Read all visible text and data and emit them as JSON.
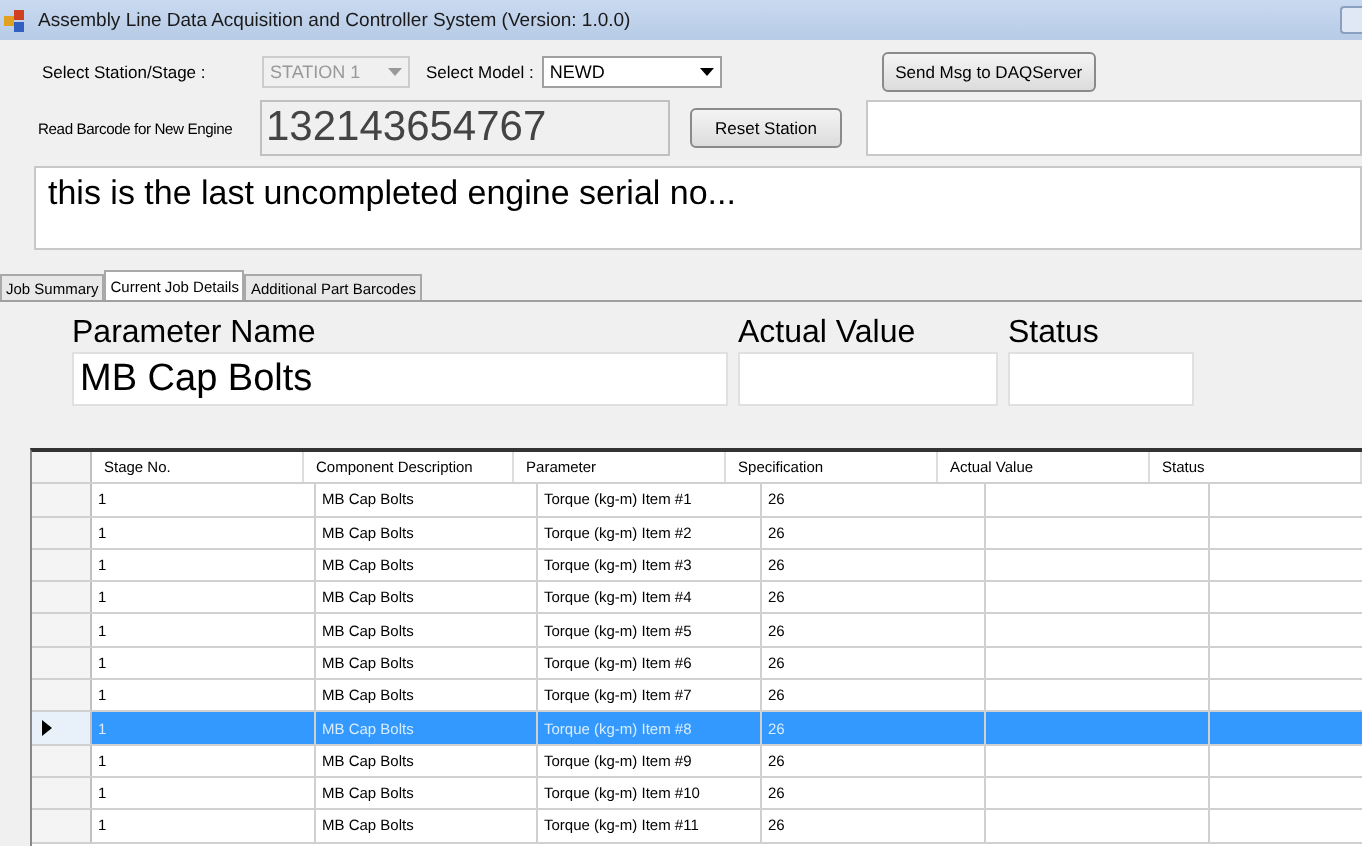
{
  "window": {
    "title": "Assembly Line Data Acquisition and Controller System (Version: 1.0.0)"
  },
  "station": {
    "label": "Select Station/Stage :",
    "value": "STATION 1",
    "disabled": true
  },
  "model": {
    "label": "Select Model :",
    "value": "NEWD",
    "disabled": false
  },
  "send_button": "Send Msg to DAQServer",
  "barcode": {
    "label": "Read Barcode for New Engine",
    "value": "132143654767"
  },
  "reset_button": "Reset Station",
  "message": "this is the last uncompleted engine serial no...",
  "tabs": [
    {
      "label": "Job Summary",
      "selected": false
    },
    {
      "label": "Current Job Details",
      "selected": true
    },
    {
      "label": "Additional Part Barcodes",
      "selected": false
    }
  ],
  "parameter": {
    "name_label": "Parameter Name",
    "name_value": "MB Cap Bolts",
    "actual_label": "Actual Value",
    "status_label": "Status"
  },
  "table": {
    "columns": [
      "Stage No.",
      "Component Description",
      "Parameter",
      "Specification",
      "Actual Value",
      "Status"
    ],
    "rows": [
      {
        "cells": [
          "1",
          "MB Cap Bolts",
          "Torque (kg-m) Item #1",
          "26",
          "",
          ""
        ],
        "selected": false
      },
      {
        "cells": [
          "1",
          "MB Cap Bolts",
          "Torque (kg-m) Item #2",
          "26",
          "",
          ""
        ],
        "selected": false
      },
      {
        "cells": [
          "1",
          "MB Cap Bolts",
          "Torque (kg-m) Item #3",
          "26",
          "",
          ""
        ],
        "selected": false
      },
      {
        "cells": [
          "1",
          "MB Cap Bolts",
          "Torque (kg-m) Item #4",
          "26",
          "",
          ""
        ],
        "selected": false
      },
      {
        "cells": [
          "1",
          "MB Cap Bolts",
          "Torque (kg-m) Item #5",
          "26",
          "",
          ""
        ],
        "selected": false
      },
      {
        "cells": [
          "1",
          "MB Cap Bolts",
          "Torque (kg-m) Item #6",
          "26",
          "",
          ""
        ],
        "selected": false
      },
      {
        "cells": [
          "1",
          "MB Cap Bolts",
          "Torque (kg-m) Item #7",
          "26",
          "",
          ""
        ],
        "selected": false
      },
      {
        "cells": [
          "1",
          "MB Cap Bolts",
          "Torque (kg-m) Item #8",
          "26",
          "",
          ""
        ],
        "selected": true
      },
      {
        "cells": [
          "1",
          "MB Cap Bolts",
          "Torque (kg-m) Item #9",
          "26",
          "",
          ""
        ],
        "selected": false
      },
      {
        "cells": [
          "1",
          "MB Cap Bolts",
          "Torque (kg-m) Item #10",
          "26",
          "",
          ""
        ],
        "selected": false
      },
      {
        "cells": [
          "1",
          "MB Cap Bolts",
          "Torque (kg-m) Item #11",
          "26",
          "",
          ""
        ],
        "selected": false
      }
    ]
  }
}
